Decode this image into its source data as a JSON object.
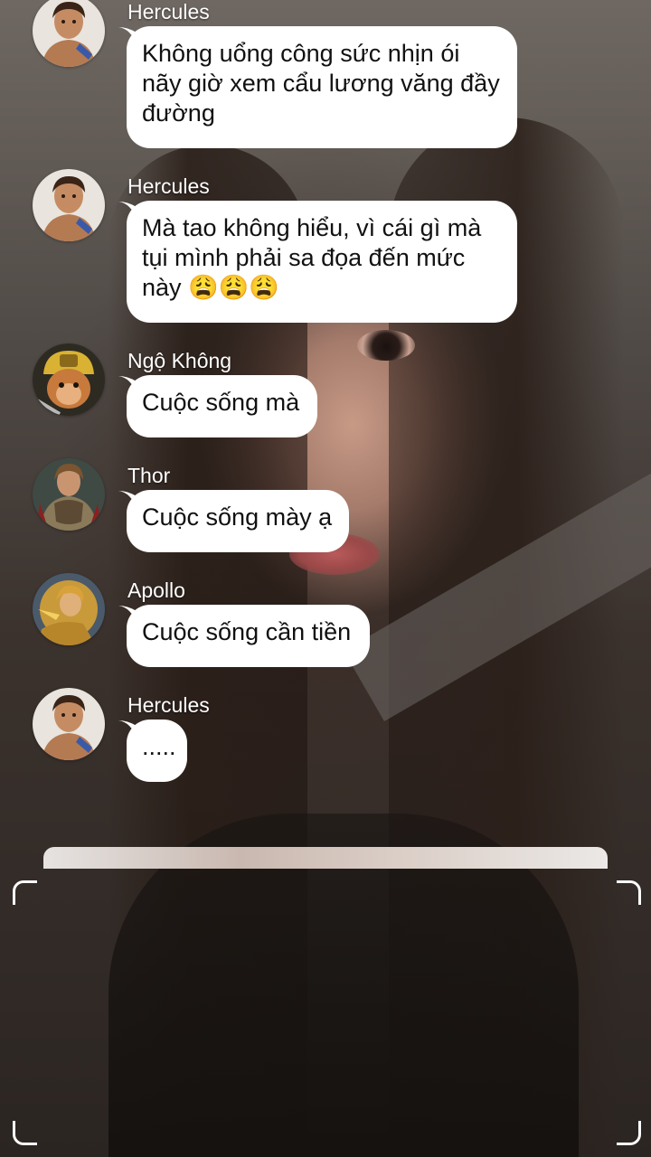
{
  "background": {
    "description_icon": "selfie-photo-background"
  },
  "messages": [
    {
      "sender": "Hercules",
      "avatar_icon": "hercules-avatar-icon",
      "lines": [
        "Không uổng công sức nhịn ói",
        "nãy giờ xem cẩu lương văng đầy",
        "đường"
      ]
    },
    {
      "sender": "Hercules",
      "avatar_icon": "hercules-avatar-icon",
      "lines": [
        "Mà tao không hiểu, vì cái gì mà",
        "tụi mình phải sa đọa đến mức",
        "này 😩😩😩"
      ]
    },
    {
      "sender": "Ngộ Không",
      "avatar_icon": "monkey-king-avatar-icon",
      "lines": [
        "Cuộc sống mà"
      ]
    },
    {
      "sender": "Thor",
      "avatar_icon": "thor-avatar-icon",
      "lines": [
        "Cuộc sống mày ạ"
      ]
    },
    {
      "sender": "Apollo",
      "avatar_icon": "apollo-avatar-icon",
      "lines": [
        "Cuộc sống cần tiền"
      ]
    },
    {
      "sender": "Hercules",
      "avatar_icon": "hercules-avatar-icon",
      "lines": [
        "....."
      ]
    }
  ],
  "colors": {
    "bubble": "#ffffff",
    "bubble_text": "#111111",
    "name_text": "#ffffff"
  }
}
